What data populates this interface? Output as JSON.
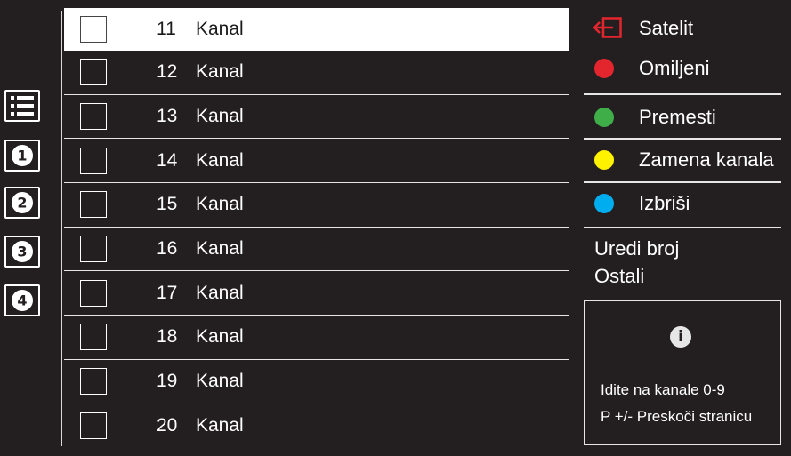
{
  "sidebar": {
    "icons": [
      {
        "name": "list-icon"
      },
      {
        "name": "number-1-icon",
        "label": "1"
      },
      {
        "name": "number-2-icon",
        "label": "2"
      },
      {
        "name": "number-3-icon",
        "label": "3"
      },
      {
        "name": "number-4-icon",
        "label": "4"
      }
    ]
  },
  "channels": [
    {
      "number": "11",
      "name": "Kanal",
      "selected": true
    },
    {
      "number": "12",
      "name": "Kanal"
    },
    {
      "number": "13",
      "name": "Kanal"
    },
    {
      "number": "14",
      "name": "Kanal"
    },
    {
      "number": "15",
      "name": "Kanal"
    },
    {
      "number": "16",
      "name": "Kanal"
    },
    {
      "number": "17",
      "name": "Kanal"
    },
    {
      "number": "18",
      "name": "Kanal"
    },
    {
      "number": "19",
      "name": "Kanal"
    },
    {
      "number": "20",
      "name": "Kanal"
    }
  ],
  "menu": {
    "source": {
      "label": "Satelit",
      "icon": "source-input-icon",
      "color": "#e3262e"
    },
    "red": {
      "label": "Omiljeni",
      "color": "#e3262e"
    },
    "green": {
      "label": "Premesti",
      "color": "#3fae49"
    },
    "yellow": {
      "label": "Zamena kanala",
      "color": "#fff200"
    },
    "blue": {
      "label": "Izbriši",
      "color": "#00aeef"
    },
    "edit_number": "Uredi broj",
    "others": "Ostali"
  },
  "info": {
    "icon": "info-icon",
    "line1": "Idite na kanale 0-9",
    "line2": "P +/- Preskoči stranicu"
  }
}
